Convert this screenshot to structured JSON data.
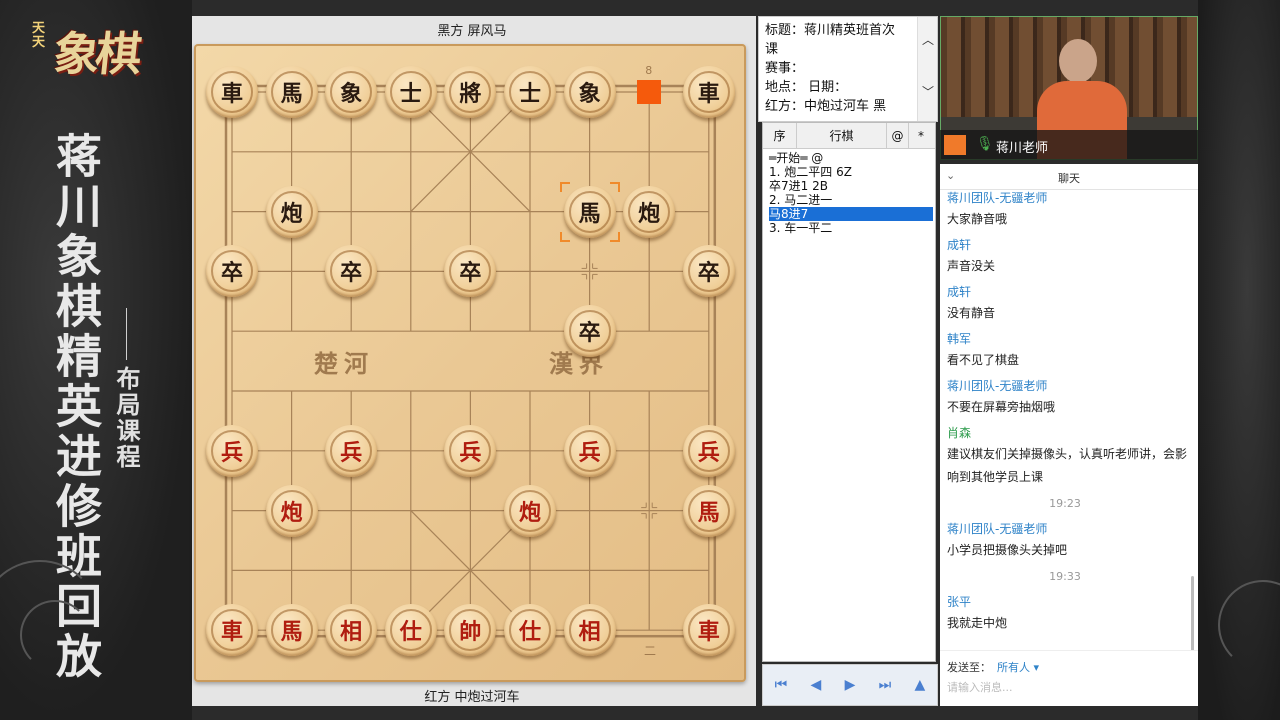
{
  "banner": {
    "logo_small": "天天",
    "logo_big": "象棋",
    "title": "蒋川象棋精英进修班回放",
    "subtitle": "布局课程"
  },
  "board": {
    "black_label": "黑方  屏风马",
    "red_label": "红方  中炮过河车",
    "river_left": "楚河",
    "river_right": "漢界",
    "marker_num": "8",
    "bottom_mark": "二",
    "pieces": [
      {
        "ch": "車",
        "side": "black",
        "col": 0,
        "row": 0
      },
      {
        "ch": "馬",
        "side": "black",
        "col": 1,
        "row": 0
      },
      {
        "ch": "象",
        "side": "black",
        "col": 2,
        "row": 0
      },
      {
        "ch": "士",
        "side": "black",
        "col": 3,
        "row": 0
      },
      {
        "ch": "將",
        "side": "black",
        "col": 4,
        "row": 0
      },
      {
        "ch": "士",
        "side": "black",
        "col": 5,
        "row": 0
      },
      {
        "ch": "象",
        "side": "black",
        "col": 6,
        "row": 0
      },
      {
        "ch": "車",
        "side": "black",
        "col": 8,
        "row": 0
      },
      {
        "ch": "炮",
        "side": "black",
        "col": 1,
        "row": 2
      },
      {
        "ch": "馬",
        "side": "black",
        "col": 6,
        "row": 2
      },
      {
        "ch": "炮",
        "side": "black",
        "col": 7,
        "row": 2
      },
      {
        "ch": "卒",
        "side": "black",
        "col": 0,
        "row": 3
      },
      {
        "ch": "卒",
        "side": "black",
        "col": 2,
        "row": 3
      },
      {
        "ch": "卒",
        "side": "black",
        "col": 4,
        "row": 3
      },
      {
        "ch": "卒",
        "side": "black",
        "col": 8,
        "row": 3
      },
      {
        "ch": "卒",
        "side": "black",
        "col": 6,
        "row": 4
      },
      {
        "ch": "兵",
        "side": "red",
        "col": 0,
        "row": 6
      },
      {
        "ch": "兵",
        "side": "red",
        "col": 2,
        "row": 6
      },
      {
        "ch": "兵",
        "side": "red",
        "col": 4,
        "row": 6
      },
      {
        "ch": "兵",
        "side": "red",
        "col": 6,
        "row": 6
      },
      {
        "ch": "兵",
        "side": "red",
        "col": 8,
        "row": 6
      },
      {
        "ch": "炮",
        "side": "red",
        "col": 1,
        "row": 7
      },
      {
        "ch": "炮",
        "side": "red",
        "col": 5,
        "row": 7
      },
      {
        "ch": "馬",
        "side": "red",
        "col": 8,
        "row": 7
      },
      {
        "ch": "車",
        "side": "red",
        "col": 0,
        "row": 9
      },
      {
        "ch": "馬",
        "side": "red",
        "col": 1,
        "row": 9
      },
      {
        "ch": "相",
        "side": "red",
        "col": 2,
        "row": 9
      },
      {
        "ch": "仕",
        "side": "red",
        "col": 3,
        "row": 9
      },
      {
        "ch": "帥",
        "side": "red",
        "col": 4,
        "row": 9
      },
      {
        "ch": "仕",
        "side": "red",
        "col": 5,
        "row": 9
      },
      {
        "ch": "相",
        "side": "red",
        "col": 6,
        "row": 9
      },
      {
        "ch": "車",
        "side": "red",
        "col": 8,
        "row": 9
      }
    ],
    "selected": {
      "col": 6,
      "row": 2
    },
    "marker": {
      "col": 7,
      "row": 0
    }
  },
  "info": {
    "lines": [
      "标题：蒋川精英班首次",
      "课",
      "赛事：",
      "地点：    日期：",
      "红方：中炮过河车    黑"
    ],
    "up": "︿",
    "down": "﹀"
  },
  "moves": {
    "headers": [
      "序",
      "行棋",
      "@",
      "*"
    ],
    "rows": [
      {
        "text": "   ═开始═ @",
        "selected": false
      },
      {
        "text": "1.  炮二平四    6Z",
        "selected": false
      },
      {
        "text": "    卒7进1    2B",
        "selected": false
      },
      {
        "text": "2.  马二进一",
        "selected": false
      },
      {
        "text": "    马8进7",
        "selected": true
      },
      {
        "text": "3.  车一平二",
        "selected": false
      }
    ]
  },
  "nav": [
    "⏮",
    "◀",
    "▶",
    "⏭",
    "▲"
  ],
  "video": {
    "name": "蒋川老师"
  },
  "chat": {
    "title": "聊天",
    "messages": [
      {
        "name": "蒋川团队-无疆老师",
        "text": "大家静音哦",
        "green": false
      },
      {
        "name": "成轩",
        "text": "声音没关",
        "green": false
      },
      {
        "name": "成轩",
        "text": "没有静音",
        "green": false
      },
      {
        "name": "韩军",
        "text": "看不见了棋盘",
        "green": false
      },
      {
        "name": "蒋川团队-无疆老师",
        "text": "不要在屏幕旁抽烟哦",
        "green": false
      },
      {
        "name": "肖森",
        "text": "建议棋友们关掉摄像头，认真听老师讲，会影响到其他学员上课",
        "green": true
      },
      {
        "time": "19:23"
      },
      {
        "name": "蒋川团队-无疆老师",
        "text": "小学员把摄像头关掉吧",
        "green": false
      },
      {
        "time": "19:33"
      },
      {
        "name": "张平",
        "text": "我就走中炮",
        "green": false
      }
    ],
    "send_to": "发送至：",
    "send_target": "所有人 ▾",
    "placeholder": "请输入消息..."
  }
}
